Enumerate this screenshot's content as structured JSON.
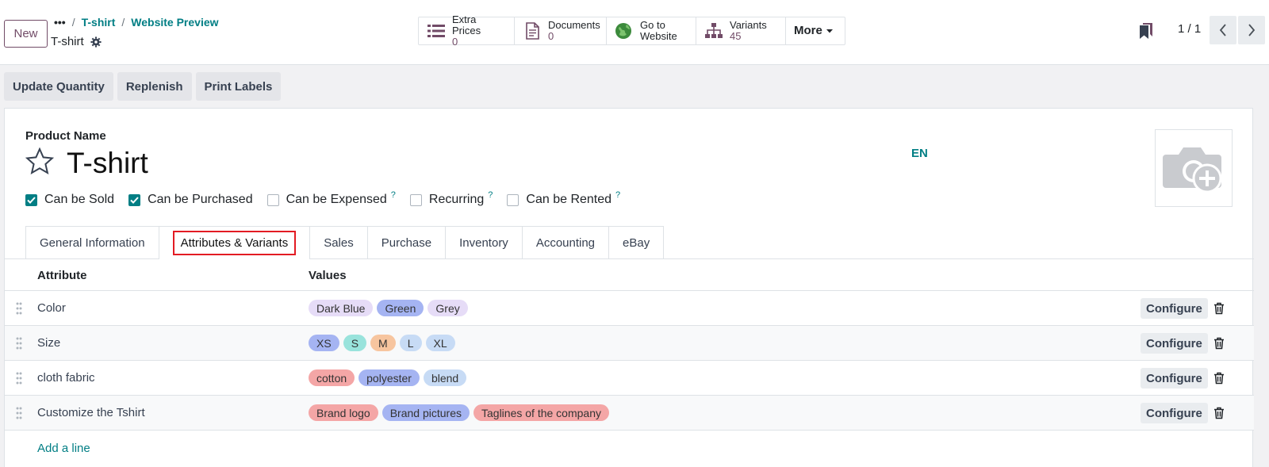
{
  "control_panel": {
    "new_label": "New",
    "breadcrumb": {
      "dots": "•••",
      "items": [
        "T-shirt",
        "Website Preview"
      ]
    },
    "record_title": "T-shirt",
    "smart_buttons": [
      {
        "icon": "list-icon",
        "label": "Extra Prices",
        "value": "0"
      },
      {
        "icon": "document-icon",
        "label": "Documents",
        "value": "0"
      },
      {
        "icon": "globe-icon",
        "label": "Go to",
        "value": "Website"
      },
      {
        "icon": "sitemap-icon",
        "label": "Variants",
        "value": "45"
      }
    ],
    "more_label": "More",
    "pager": "1 / 1"
  },
  "actions": [
    "Update Quantity",
    "Replenish",
    "Print Labels"
  ],
  "form": {
    "product_name_label": "Product Name",
    "product_name": "T-shirt",
    "lang": "EN",
    "checkboxes": [
      {
        "label": "Can be Sold",
        "checked": true,
        "help": ""
      },
      {
        "label": "Can be Purchased",
        "checked": true,
        "help": ""
      },
      {
        "label": "Can be Expensed",
        "checked": false,
        "help": "?"
      },
      {
        "label": "Recurring",
        "checked": false,
        "help": "?"
      },
      {
        "label": "Can be Rented",
        "checked": false,
        "help": "?"
      }
    ],
    "tabs": [
      "General Information",
      "Attributes & Variants",
      "Sales",
      "Purchase",
      "Inventory",
      "Accounting",
      "eBay"
    ],
    "active_tab": "Attributes & Variants"
  },
  "attributes": {
    "headers": {
      "attribute": "Attribute",
      "values": "Values"
    },
    "rows": [
      {
        "name": "Color",
        "values": [
          {
            "text": "Dark Blue",
            "color": "#e6dcf7"
          },
          {
            "text": "Green",
            "color": "#a5b4f2"
          },
          {
            "text": "Grey",
            "color": "#e6dcf7"
          }
        ]
      },
      {
        "name": "Size",
        "values": [
          {
            "text": "XS",
            "color": "#a5b4f2"
          },
          {
            "text": "S",
            "color": "#99e3dc"
          },
          {
            "text": "M",
            "color": "#f7c59f"
          },
          {
            "text": "L",
            "color": "#c7dbf5"
          },
          {
            "text": "XL",
            "color": "#c7dbf5"
          }
        ]
      },
      {
        "name": "cloth fabric",
        "values": [
          {
            "text": "cotton",
            "color": "#f4a6a6"
          },
          {
            "text": "polyester",
            "color": "#a5b4f2"
          },
          {
            "text": "blend",
            "color": "#c7dbf5"
          }
        ]
      },
      {
        "name": "Customize the Tshirt",
        "values": [
          {
            "text": "Brand logo",
            "color": "#f4a6a6"
          },
          {
            "text": "Brand pictures",
            "color": "#a5b4f2"
          },
          {
            "text": "Taglines of the company",
            "color": "#f4a6a6"
          }
        ]
      }
    ],
    "configure_label": "Configure",
    "add_line": "Add a line"
  },
  "colors": {
    "primary": "#714b67",
    "accent": "#017e84",
    "highlight": "#e31b23"
  }
}
